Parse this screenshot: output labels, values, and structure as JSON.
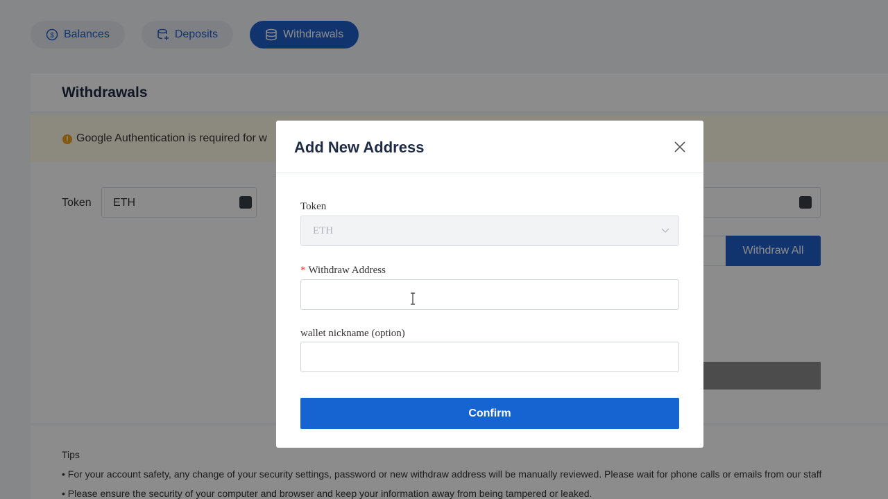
{
  "tabs": [
    {
      "label": "Balances",
      "icon": "dollar-circle-icon",
      "active": false
    },
    {
      "label": "Deposits",
      "icon": "coins-plus-icon",
      "active": false
    },
    {
      "label": "Withdrawals",
      "icon": "coins-stack-icon",
      "active": true
    }
  ],
  "page": {
    "title": "Withdrawals",
    "notice": "Google Authentication is required for w",
    "token_label": "Token",
    "token_value": "ETH",
    "withdraw_all_label": "Withdraw All"
  },
  "tips": {
    "title": "Tips",
    "items": [
      "• For your account safety, any change of your security settings, password or new withdraw address will be manually reviewed. Please wait for phone calls or emails from our staff",
      "• Please ensure the security of your computer and browser and keep your information away from being tampered or leaked."
    ]
  },
  "modal": {
    "title": "Add New Address",
    "token_label": "Token",
    "token_value": "ETH",
    "address_required_mark": "*",
    "address_label": "Withdraw Address",
    "address_value": "",
    "nickname_label": "wallet nickname (option)",
    "nickname_value": "",
    "confirm_label": "Confirm"
  },
  "colors": {
    "accent": "#1664d1",
    "required": "#e0352b",
    "warning": "#f0a020"
  }
}
